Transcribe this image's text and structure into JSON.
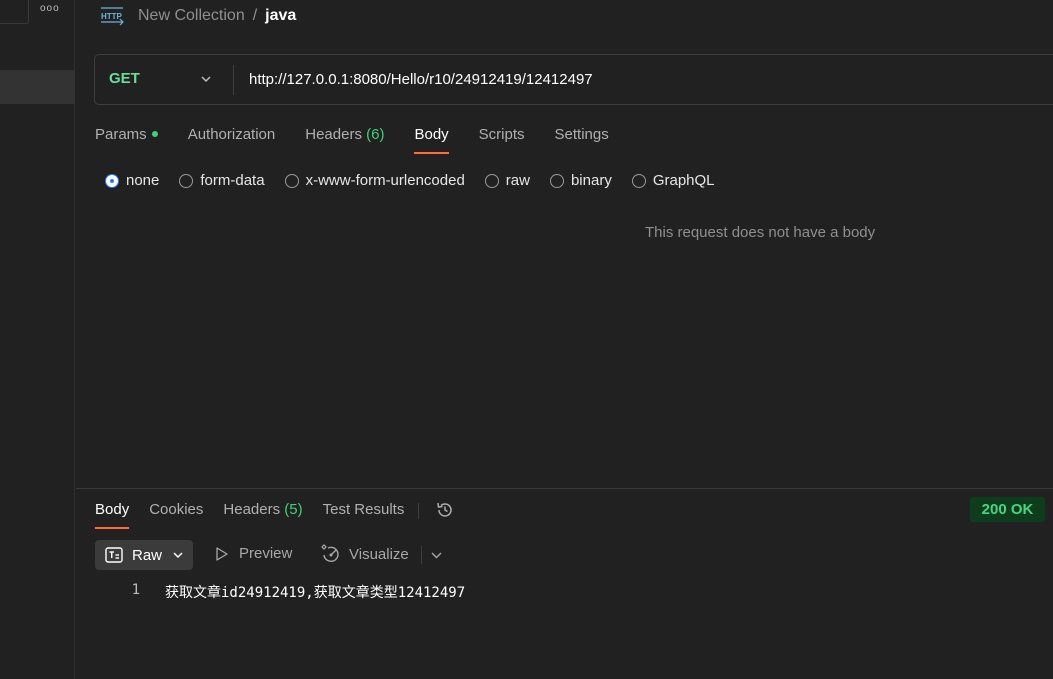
{
  "sidebar": {
    "more_label": "ooo"
  },
  "header": {
    "icon_label": "HTTP",
    "collection": "New Collection",
    "separator": "/",
    "request_name": "java"
  },
  "request": {
    "method": "GET",
    "url": "http://127.0.0.1:8080/Hello/r10/24912419/12412497",
    "tabs": {
      "params": "Params",
      "authorization": "Authorization",
      "headers": "Headers",
      "headers_count": "(6)",
      "body": "Body",
      "scripts": "Scripts",
      "settings": "Settings"
    },
    "active_tab": "Body",
    "body_types": {
      "none": "none",
      "form_data": "form-data",
      "urlencoded": "x-www-form-urlencoded",
      "raw": "raw",
      "binary": "binary",
      "graphql": "GraphQL"
    },
    "selected_body_type": "none",
    "empty_body_message": "This request does not have a body"
  },
  "response": {
    "tabs": {
      "body": "Body",
      "cookies": "Cookies",
      "headers": "Headers",
      "headers_count": "(5)",
      "test_results": "Test Results"
    },
    "status": "200 OK",
    "format": {
      "raw": "Raw",
      "preview": "Preview",
      "visualize": "Visualize"
    },
    "lines": [
      {
        "number": "1",
        "text": "获取文章id24912419,获取文章类型12412497"
      }
    ]
  },
  "colors": {
    "accent": "#ff6c37",
    "method_get": "#6bdd9a",
    "status_ok": "#49d67f",
    "radio_selected": "#1f7ee8"
  }
}
